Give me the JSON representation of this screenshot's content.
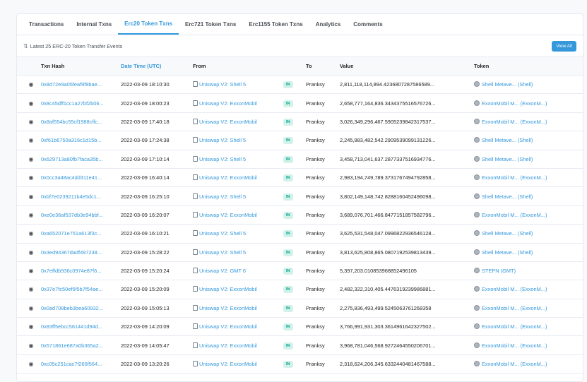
{
  "tabs": [
    {
      "label": "Transactions",
      "active": false
    },
    {
      "label": "Internal Txns",
      "active": false
    },
    {
      "label": "Erc20 Token Txns",
      "active": true
    },
    {
      "label": "Erc721 Token Txns",
      "active": false
    },
    {
      "label": "Erc1155 Token Txns",
      "active": false
    },
    {
      "label": "Analytics",
      "active": false
    },
    {
      "label": "Comments",
      "active": false
    }
  ],
  "subtitle": "Latest 25 ERC-20 Token Transfer Events",
  "view_all_label": "View All",
  "columns": {
    "hash": "Txn Hash",
    "date": "Date Time (UTC)",
    "from": "From",
    "to": "To",
    "value": "Value",
    "token": "Token"
  },
  "badge_label": "IN",
  "rows": [
    {
      "hash": "0x8d72e9a05feaf9f9bae...",
      "date": "2022-03-09 18:10:30",
      "from": "Uniswap V2: Shell 5",
      "to": "Pranksy",
      "value": "2,811,118,114,894.4236807287586589...",
      "token": "Shell Metave... (Shell)"
    },
    {
      "hash": "0x8c45dff1cc1a27bf2b06...",
      "date": "2022-03-09 18:00:23",
      "from": "Uniswap V2: ExxonMobil",
      "to": "Pranksy",
      "value": "2,658,777,164,836.3434375516576726...",
      "token": "ExxonMobil M... (ExxonM...)"
    },
    {
      "hash": "0x8af554bc55cf1988cffc...",
      "date": "2022-03-09 17:40:18",
      "from": "Uniswap V2: ExxonMobil",
      "to": "Pranksy",
      "value": "3,026,349,296,467.5905239842317537...",
      "token": "ExxonMobil M... (ExxonM...)"
    },
    {
      "hash": "0xf61b6750a316c1d15b...",
      "date": "2022-03-09 17:24:38",
      "from": "Uniswap V2: Shell 5",
      "to": "Pranksy",
      "value": "2,245,983,482,542.2909539099131226...",
      "token": "Shell Metave... (Shell)"
    },
    {
      "hash": "0x629713a80fb7faca35b...",
      "date": "2022-03-09 17:10:14",
      "from": "Uniswap V2: Shell 5",
      "to": "Pranksy",
      "value": "3,458,713,041,637.2877337516934776...",
      "token": "Shell Metave... (Shell)"
    },
    {
      "hash": "0x0cc3a48ac4dd311e41...",
      "date": "2022-03-09 16:40:14",
      "from": "Uniswap V2: ExxonMobil",
      "to": "Pranksy",
      "value": "2,983,194,749,789.3731767494792858...",
      "token": "ExxonMobil M... (ExxonM...)"
    },
    {
      "hash": "0xbf7e0239211b4e5dc1...",
      "date": "2022-03-09 16:25:10",
      "from": "Uniswap V2: Shell 5",
      "to": "Pranksy",
      "value": "3,802,149,148,742.8288160452496098...",
      "token": "Shell Metave... (Shell)"
    },
    {
      "hash": "0xe0e36af537db3e94bbf...",
      "date": "2022-03-09 16:20:07",
      "from": "Uniswap V2: ExxonMobil",
      "to": "Pranksy",
      "value": "3,689,076,701,466.8477151857582796...",
      "token": "ExxonMobil M... (ExxonM...)"
    },
    {
      "hash": "0xa652071e751a613f3c...",
      "date": "2022-03-09 16:10:21",
      "from": "Uniswap V2: Shell 5",
      "to": "Pranksy",
      "value": "3,625,531,548,047.0996822936546128...",
      "token": "Shell Metave... (Shell)"
    },
    {
      "hash": "0x3ed94367dadf497238...",
      "date": "2022-03-09 15:28:22",
      "from": "Uniswap V2: Shell 5",
      "to": "Pranksy",
      "value": "3,813,625,808,865.0807192539813439...",
      "token": "Shell Metave... (Shell)"
    },
    {
      "hash": "0x7effdb936c0974e87f6...",
      "date": "2022-03-09 15:20:24",
      "from": "Uniswap V2: GMT 6",
      "to": "Pranksy",
      "value": "5,397,203.010853968852496105",
      "token": "STEPN (GMT)"
    },
    {
      "hash": "0x37e7fc50ef5f5b7f54ae...",
      "date": "2022-03-09 15:20:09",
      "from": "Uniswap V2: ExxonMobil",
      "to": "Pranksy",
      "value": "2,482,322,310,405.4476319239986881...",
      "token": "ExxonMobil M... (ExxonM...)"
    },
    {
      "hash": "0x0ad708beb3bea60932...",
      "date": "2022-03-09 15:05:13",
      "from": "Uniswap V2: ExxonMobil",
      "to": "Pranksy",
      "value": "2,275,836,493,499.5245063761268358",
      "token": "ExxonMobil M... (ExxonM...)"
    },
    {
      "hash": "0x83ff5ebcc561441d94d...",
      "date": "2022-03-09 14:20:09",
      "from": "Uniswap V2: ExxonMobil",
      "to": "Pranksy",
      "value": "3,766,991,931,303.3614961642327502...",
      "token": "ExxonMobil M... (ExxonM...)"
    },
    {
      "hash": "0x571861e687a0b365a2...",
      "date": "2022-03-09 14:05:47",
      "from": "Uniswap V2: ExxonMobil",
      "to": "Pranksy",
      "value": "3,968,781,046,568.9272464550206701...",
      "token": "ExxonMobil M... (ExxonM...)"
    },
    {
      "hash": "0xc05c251cac7f265f564...",
      "date": "2022-03-09 13:20:26",
      "from": "Uniswap V2: ExxonMobil",
      "to": "Pranksy",
      "value": "2,318,624,206,345.6332440481467588...",
      "token": "ExxonMobil M... (ExxonM...)"
    }
  ]
}
